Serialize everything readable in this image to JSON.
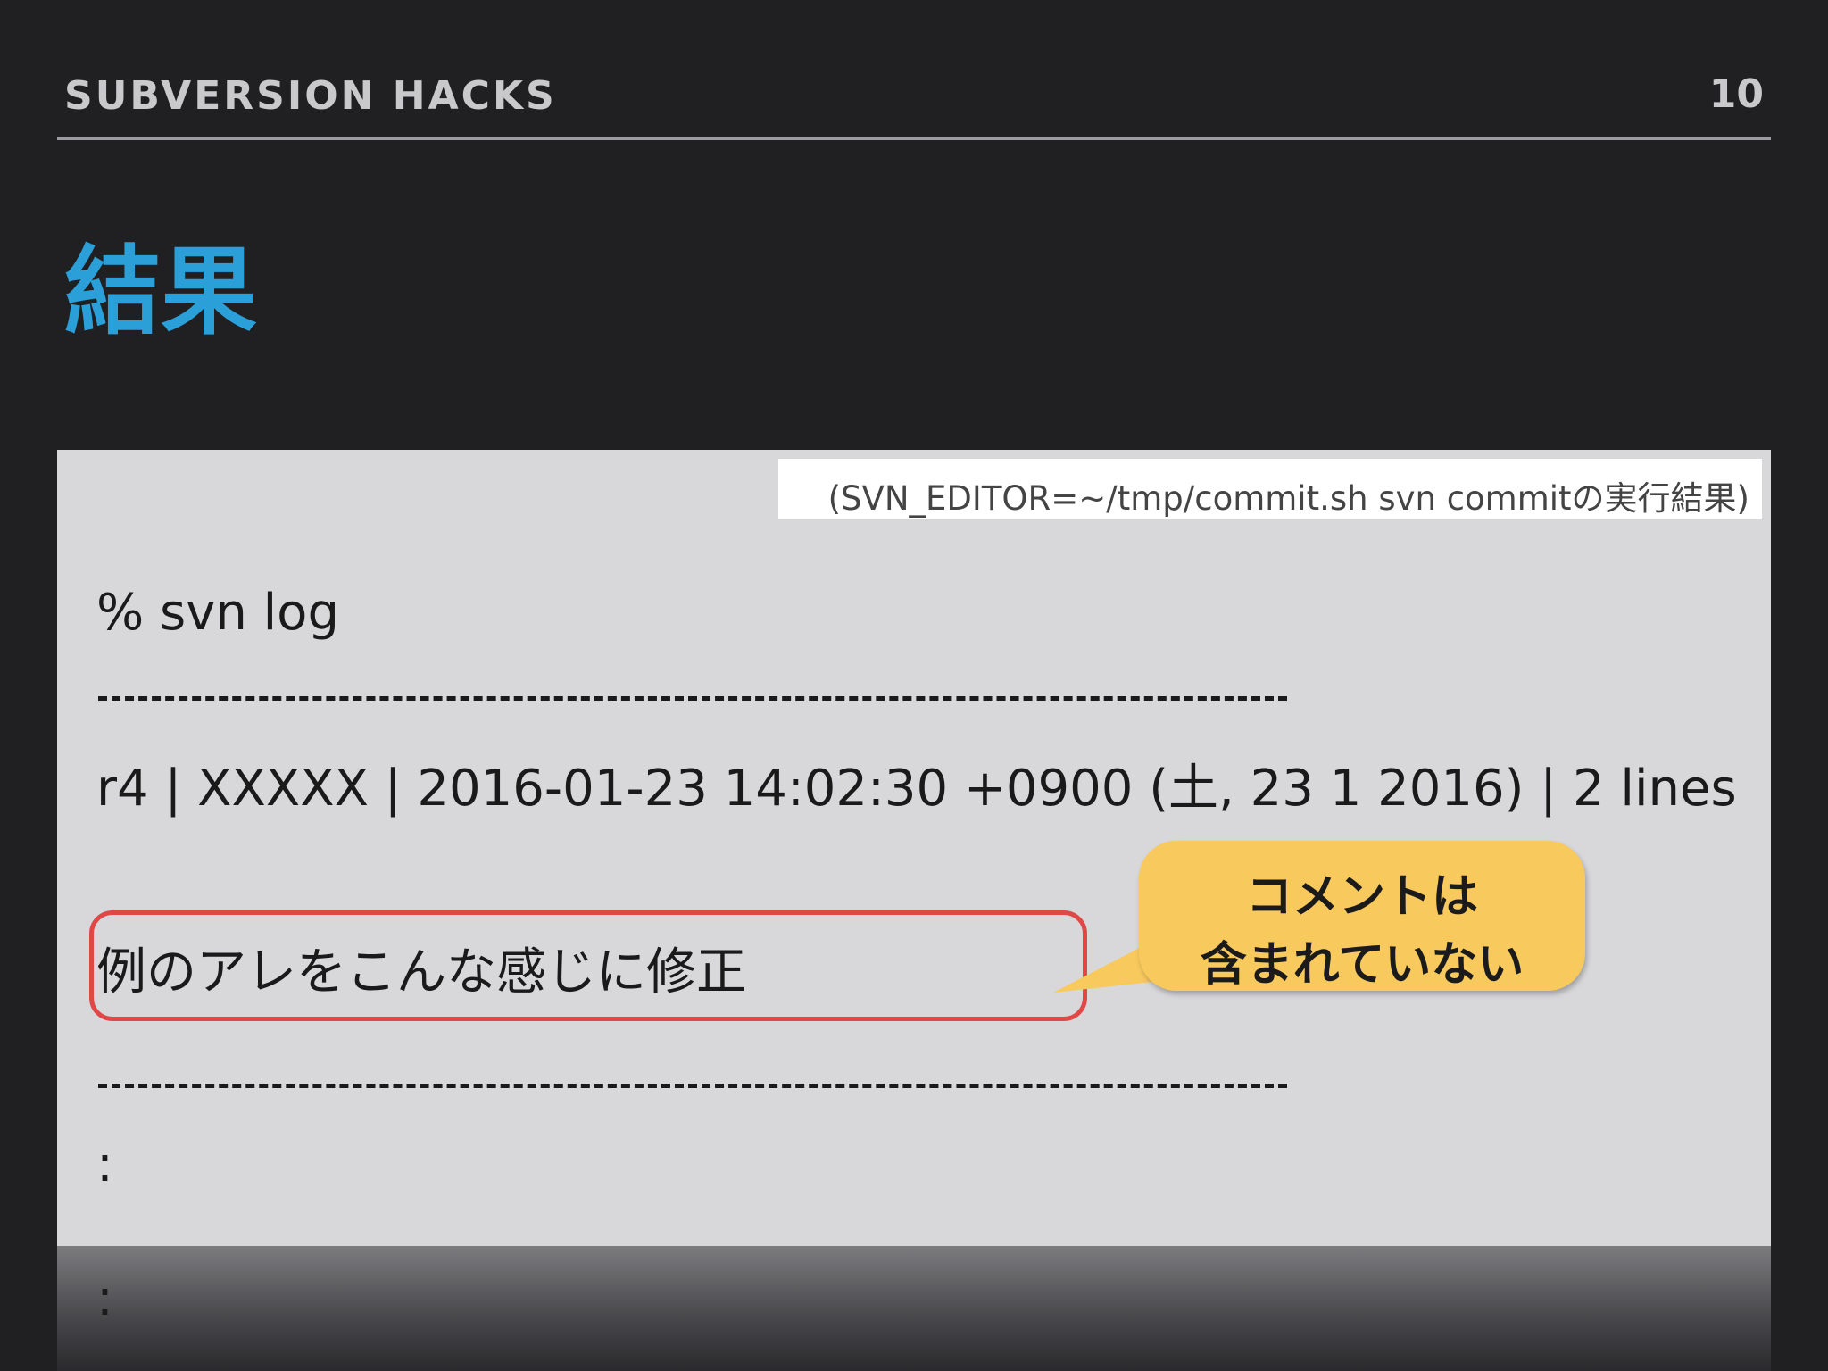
{
  "header": {
    "title": "SUBVERSION HACKS",
    "page_number": "10"
  },
  "slide_title": "結果",
  "terminal": {
    "caption": "(SVN_EDITOR=~/tmp/commit.sh svn commitの実行結果)",
    "command": "% svn log",
    "log_entry": "r4 | XXXXX | 2016-01-23 14:02:30 +0900 (土, 23  1 2016) | 2 lines",
    "message": "例のアレをこんな感じに修正",
    "colon_1": ":",
    "colon_2": ":"
  },
  "callout": {
    "line_1": "コメントは",
    "line_2": "含まれていない"
  },
  "colors": {
    "background": "#202023",
    "title_accent": "#2a9fd8",
    "terminal_bg": "#d8d7da",
    "highlight": "#e04848",
    "callout": "#f8c95d"
  }
}
